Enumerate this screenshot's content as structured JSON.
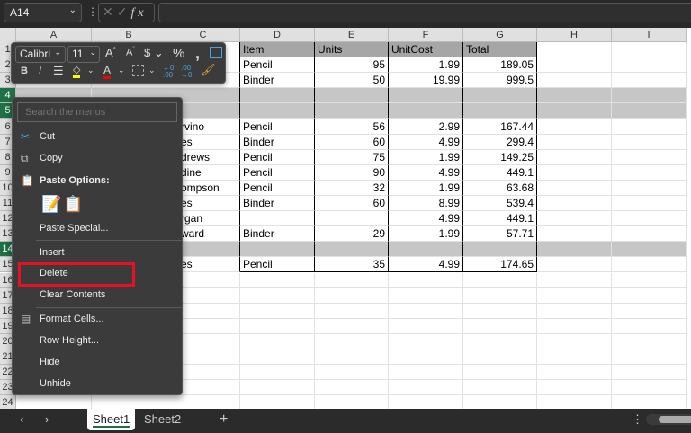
{
  "namebox": "A14",
  "formula_value": "",
  "columns": [
    "A",
    "B",
    "C",
    "D",
    "E",
    "F",
    "G",
    "H",
    "I"
  ],
  "rows": [
    {
      "n": 1,
      "cells": {
        "D": "Item",
        "E": "Units",
        "F": "UnitCost",
        "G": "Total"
      }
    },
    {
      "n": 2,
      "cells": {
        "D": "Pencil",
        "E": "95",
        "F": "1.99",
        "G": "189.05"
      }
    },
    {
      "n": 3,
      "cells": {
        "D": "Binder",
        "E": "50",
        "F": "19.99",
        "G": "999.5"
      }
    },
    {
      "n": 4,
      "cells": {},
      "selected": true
    },
    {
      "n": 5,
      "cells": {},
      "selected": true
    },
    {
      "n": 6,
      "cells": {
        "C": "rvino",
        "D": "Pencil",
        "E": "56",
        "F": "2.99",
        "G": "167.44"
      }
    },
    {
      "n": 7,
      "cells": {
        "C": "es",
        "D": "Binder",
        "E": "60",
        "F": "4.99",
        "G": "299.4"
      }
    },
    {
      "n": 8,
      "cells": {
        "C": "drews",
        "D": "Pencil",
        "E": "75",
        "F": "1.99",
        "G": "149.25"
      }
    },
    {
      "n": 9,
      "cells": {
        "C": "dine",
        "D": "Pencil",
        "E": "90",
        "F": "4.99",
        "G": "449.1"
      }
    },
    {
      "n": 10,
      "cells": {
        "C": "ompson",
        "D": "Pencil",
        "E": "32",
        "F": "1.99",
        "G": "63.68"
      }
    },
    {
      "n": 11,
      "cells": {
        "C": "es",
        "D": "Binder",
        "E": "60",
        "F": "8.99",
        "G": "539.4"
      }
    },
    {
      "n": 12,
      "cells": {
        "C": "rgan",
        "F": "4.99",
        "G": "449.1"
      }
    },
    {
      "n": 13,
      "cells": {
        "C": "ward",
        "D": "Binder",
        "E": "29",
        "F": "1.99",
        "G": "57.71"
      }
    },
    {
      "n": 14,
      "cells": {},
      "selected": true
    },
    {
      "n": 15,
      "cells": {
        "C": "es",
        "D": "Pencil",
        "E": "35",
        "F": "4.99",
        "G": "174.65"
      }
    },
    {
      "n": 16,
      "cells": {}
    },
    {
      "n": 17,
      "cells": {}
    },
    {
      "n": 18,
      "cells": {}
    },
    {
      "n": 19,
      "cells": {}
    },
    {
      "n": 20,
      "cells": {}
    },
    {
      "n": 21,
      "cells": {}
    },
    {
      "n": 22,
      "cells": {}
    },
    {
      "n": 23,
      "cells": {}
    },
    {
      "n": 24,
      "cells": {}
    }
  ],
  "mini_toolbar": {
    "font": "Calibri",
    "size": "11",
    "fill_color": "#ffff00",
    "font_color": "#ff0000"
  },
  "menu": {
    "search_placeholder": "Search the menus",
    "cut": "Cut",
    "copy": "Copy",
    "paste_options": "Paste Options:",
    "paste_special": "Paste Special...",
    "insert": "Insert",
    "delete": "Delete",
    "clear_contents": "Clear Contents",
    "format_cells": "Format Cells...",
    "row_height": "Row Height...",
    "hide": "Hide",
    "unhide": "Unhide"
  },
  "highlight_color": "#e81123",
  "tabs": [
    "Sheet1",
    "Sheet2"
  ],
  "active_tab": "Sheet1"
}
